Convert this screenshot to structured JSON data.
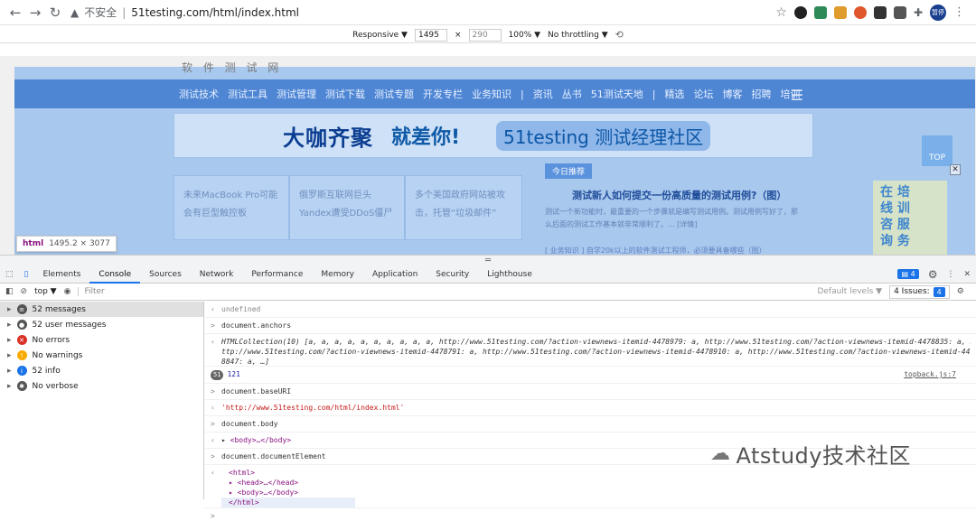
{
  "browser": {
    "insecure_label": "不安全",
    "url": "51testing.com/html/index.html",
    "avatar_text": "暂停"
  },
  "device_toolbar": {
    "mode": "Responsive ▼",
    "width": "1495",
    "times": "×",
    "height": "290",
    "zoom": "100% ▼",
    "throttle": "No throttling ▼"
  },
  "page": {
    "logo_text": "软 件 测 试 网",
    "menu": [
      "测试技术",
      "测试工具",
      "测试管理",
      "测试下载",
      "测试专题",
      "开发专栏",
      "业务知识",
      "|",
      "资讯",
      "丛书",
      "51测试天地",
      "|",
      "精选",
      "论坛",
      "博客",
      "招聘",
      "培训"
    ],
    "banner_a": "大咖齐聚",
    "banner_b": "就差你!",
    "banner_c": "51testing 测试经理社区",
    "top_button": "TOP",
    "news": [
      {
        "l1": "未来MacBook Pro可能",
        "l2": "会有巨型触控板"
      },
      {
        "l1": "俄罗斯互联网巨头",
        "l2": "Yandex遭受DDoS僵尸"
      },
      {
        "l1": "多个美国政府网站被攻",
        "l2": "击，托管“垃圾邮件”"
      }
    ],
    "rec_badge": "今日推荐",
    "rec_title": "测试新人如何提交一份高质量的测试用例?（图）",
    "rec_desc": "测试一个新功能时，最重要的一个步骤就是编写测试用例。测试用例写好了，那么后面的测试工作基本就非常顺利了。... [详情]",
    "rec_more": "[ 业务知识 ] 自学20k以上的软件测试工程师，必须要具备哪些（图）",
    "close_x": "✕",
    "side_ad": [
      "在 培",
      "线 训",
      "咨 服",
      "询 务"
    ]
  },
  "tooltip": {
    "tag": "html",
    "size": "1495.2 × 3077"
  },
  "devtools": {
    "tabs": [
      "Elements",
      "Console",
      "Sources",
      "Network",
      "Performance",
      "Memory",
      "Application",
      "Security",
      "Lighthouse"
    ],
    "issue_count": "4",
    "context": "top ▼",
    "filter_placeholder": "Filter",
    "levels": "Default levels ▼",
    "issues_label": "4 Issues:",
    "issues_num": "4"
  },
  "sidebar": [
    {
      "label": "52 messages",
      "icon": "list-icon",
      "color": "#555"
    },
    {
      "label": "52 user messages",
      "icon": "user-icon",
      "color": "#555"
    },
    {
      "label": "No errors",
      "icon": "error-icon",
      "color": "#d93025"
    },
    {
      "label": "No warnings",
      "icon": "warning-icon",
      "color": "#f9ab00"
    },
    {
      "label": "52 info",
      "icon": "info-icon",
      "color": "#1a73e8"
    },
    {
      "label": "No verbose",
      "icon": "bug-icon",
      "color": "#555"
    }
  ],
  "console": {
    "l0": "undefined",
    "l1": "document.anchors",
    "l2a": "HTMLCollection(10) [a, a, a, a, a, a, a, a, a, a, http://www.51testing.com/?action-viewnews-itemid-4478979: a, http://www.51testing.com/?action-viewnews-itemid-4478835: a, h",
    "l2b": "ttp://www.51testing.com/?action-viewnews-itemid-4478791: a, http://www.51testing.com/?action-viewnews-itemid-4478910: a, http://www.51testing.com/?action-viewnews-itemid-447",
    "l2c": "8847: a, …]",
    "count_badge": "51",
    "count_val": "121",
    "src_link": "topback.js:7",
    "l3": "document.baseURI",
    "l4": "'http://www.51testing.com/html/index.html'",
    "l5": "document.body",
    "l6": "<body>…</body>",
    "l7": "document.documentElement",
    "t1": "<html>",
    "t2": "<head>…</head>",
    "t3": "<body>…</body>",
    "t4": "</html>",
    "prompt": ">"
  },
  "watermark": "Atstudy技术社区"
}
